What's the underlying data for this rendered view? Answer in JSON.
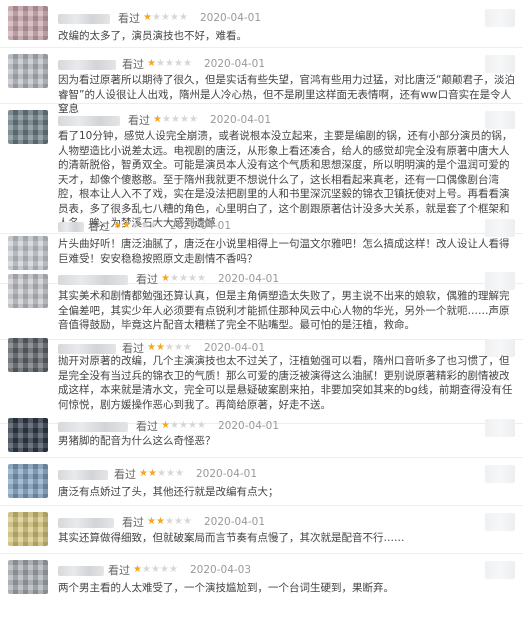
{
  "reviews": [
    {
      "watched": "看过",
      "rating": 1,
      "date": "2020-04-01",
      "avatar_color": "#c9a6ad",
      "text": "改编的太多了，演员演技也不好，难看。"
    },
    {
      "watched": "看过",
      "rating": 1,
      "date": "2020-04-01",
      "avatar_color": "#b7bcc2",
      "text": "因为看过原著所以期待了很久，但是实话有些失望，官鸿有些用力过猛，对比唐泛“颠颠君子，淡泊睿智”的人设很让人出戏，隋州是人冷心热，但不是刷里这样面无表情啊，还有ww口音实在是令人窒息"
    },
    {
      "watched": "看过",
      "rating": 1,
      "date": "2020-04-01",
      "avatar_color": "#6d7f86",
      "text": "看了10分钟，感觉人设完全崩溃，或者说根本没立起来，主要是编剧的锅，还有小部分演员的锅，人物塑造比小说差太远。电视剧的唐泛，从形象上看还凑合，给人的感觉却完全没有原著中唐大人的清新脱俗，智勇双全。可能是演员本人没有这个气质和思想深度，所以明明演的是个温润可爱的天才，却像个傻憨憨。至于隋州我就更不想说什么了，这长相看起来真老，还有一口偶像剧台湾腔，根本让人入不了戏，实在是没法把剧里的人和书里深沉坚毅的锦衣卫镇抚使对上号。再看看演员表，多了很多乱七八糟的角色，心里明白了，这个剧跟原著估计没多大关系，就是套了个框架和人名。唉，为梦溪石大大感到遗憾"
    },
    {
      "watched": "看过",
      "rating": 2,
      "date": "2020-04-01",
      "avatar_color": "#c8cdd2",
      "text": "片头曲好听！唐泛油腻了，唐泛在小说里相得上一句温文尔雅吧！怎么搞成这样！改人设让人看得巨难受！安安稳稳按照原文走剧情不香吗？"
    },
    {
      "watched": "看过",
      "rating": 1,
      "date": "2020-04-01",
      "avatar_color": "#c3c6c9",
      "text": "其实美术和剧情都勉强还算认真，但是主角俩塑造太失败了，男主说不出来的娘软，偶雅的理解完全偏差吧，其实少年人必须要有点锐利才能抓住那种风云中心人物的华光，另外一个就呃……声原音值得鼓励，毕竟这片配音太糟糕了完全不贴嘴型。最可怕的是汪植，救命。"
    },
    {
      "watched": "看过",
      "rating": 2,
      "date": "2020-04-01",
      "avatar_color": "#5f656b",
      "text": "抛开对原著的改编，几个主演演技也太不过关了，汪植勉强可以看，隋州口音听多了也习惯了，但是完全没有当过兵的锦衣卫的气质！那么可爱的唐泛被演得这么油腻！更别说原著精彩的剧情被改成这样，本来就是清水文，完全可以是悬疑破案剧来拍，非要加突如其来的bg线，前期查得没有任何惊悦，剧方媛操作恶心到我了。再简给原著，好走不送。"
    },
    {
      "watched": "看过",
      "rating": 1,
      "date": "2020-04-01",
      "avatar_color": "#2f3a48",
      "text": "男猪脚的配音为什么这么奇怪恶？"
    },
    {
      "watched": "看过",
      "rating": 2,
      "date": "2020-04-01",
      "avatar_color": "#7fa0be",
      "text": "唐泛有点娇过了头，其他还行就是改编有点大；"
    },
    {
      "watched": "看过",
      "rating": 2,
      "date": "2020-04-01",
      "avatar_color": "#d4c47a",
      "text": "其实还算做得细致，但就破案局而言节奏有点慢了，其次就是配音不行……"
    },
    {
      "watched": "看过",
      "rating": 1,
      "date": "2020-04-03",
      "avatar_color": "#a7adb3",
      "text": "两个男主看的人太难受了，一个演技尴尬到，一个台词生硬到，果断弃。"
    }
  ]
}
